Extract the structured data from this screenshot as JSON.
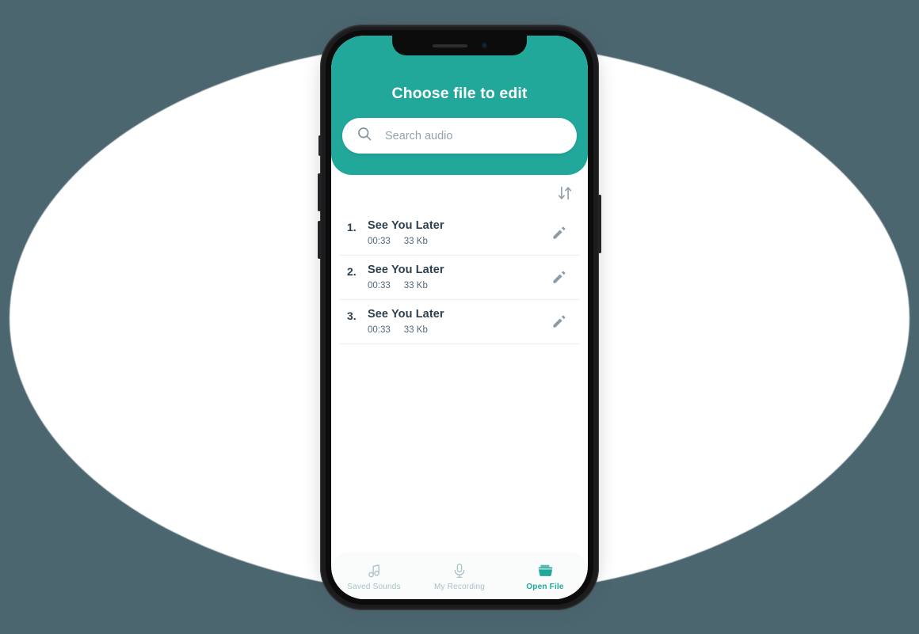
{
  "background": {
    "page_color": "#4c6670",
    "ellipse_color": "#ffffff"
  },
  "device": {
    "frame_color": "#1c1c1e",
    "buttons": [
      "silent-switch",
      "volume-up",
      "volume-down",
      "power"
    ]
  },
  "theme": {
    "accent": "#22a89a",
    "text_dark": "#2d3f4f",
    "text_muted": "#53687a",
    "nav_inactive": "#a8c2c6"
  },
  "header": {
    "title": "Choose file to edit",
    "search_icon": "search-icon"
  },
  "search": {
    "placeholder": "Search audio",
    "value": ""
  },
  "list": {
    "sort_icon": "sort-down-up-icon",
    "edit_icon": "pencil-icon",
    "columns": [
      "index",
      "title",
      "duration",
      "size"
    ],
    "items": [
      {
        "index": "1.",
        "title": "See You Later",
        "duration": "00:33",
        "size": "33 Kb"
      },
      {
        "index": "2.",
        "title": "See You Later",
        "duration": "00:33",
        "size": "33 Kb"
      },
      {
        "index": "3.",
        "title": "See You Later",
        "duration": "00:33",
        "size": "33 Kb"
      }
    ]
  },
  "bottom_nav": {
    "active_index": 2,
    "items": [
      {
        "label": "Saved Sounds",
        "icon": "music-note-icon",
        "active": false
      },
      {
        "label": "My Recording",
        "icon": "microphone-icon",
        "active": false
      },
      {
        "label": "Open File",
        "icon": "folder-icon",
        "active": true
      }
    ]
  }
}
